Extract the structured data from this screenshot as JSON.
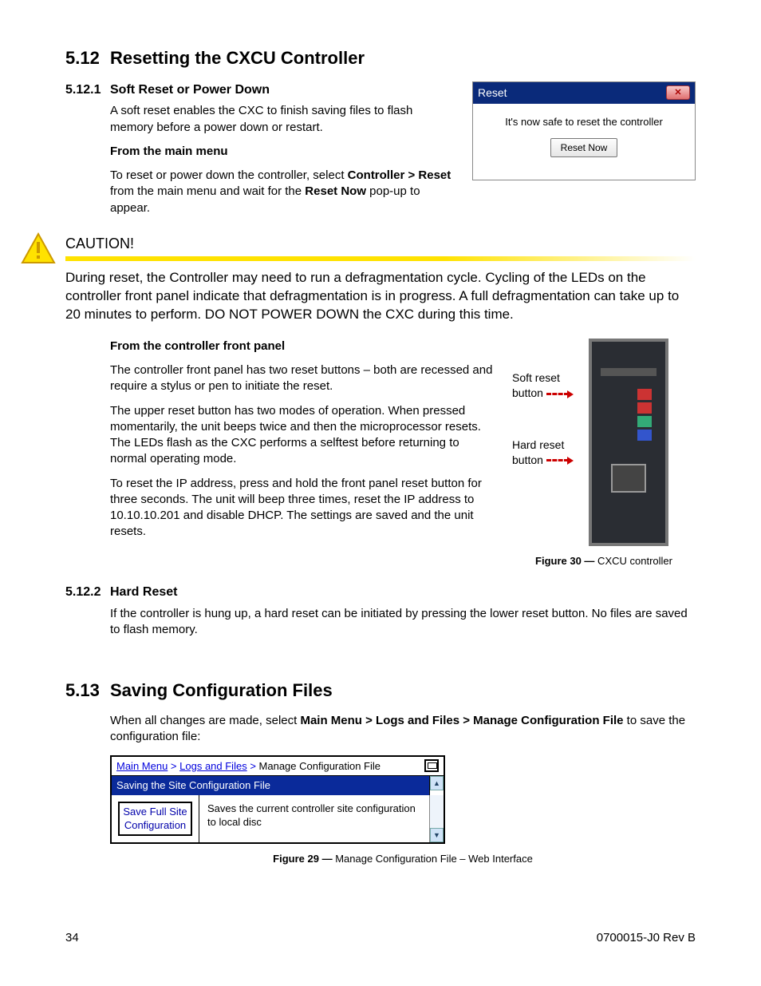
{
  "section512": {
    "num": "5.12",
    "title": "Resetting the CXCU Controller",
    "s1": {
      "num": "5.12.1",
      "title": "Soft Reset or Power Down",
      "p1": "A soft reset enables the CXC to finish saving files to flash memory before a power down or restart.",
      "h_from_main": "From the main menu",
      "p2a": "To reset or power down the controller, select ",
      "p2b": "Controller > Reset",
      "p2c": " from the main menu and wait for the ",
      "p2d": "Reset Now",
      "p2e": " pop-up to appear."
    },
    "dialog": {
      "title": "Reset",
      "msg": "It's now safe to reset the controller",
      "btn": "Reset Now"
    },
    "caution": {
      "head": "CAUTION!",
      "text": "During reset, the Controller may need to run a defragmentation cycle. Cycling of the LEDs on the controller front panel indicate that defragmentation is in progress. A full defragmentation can take up to 20 minutes to perform. DO NOT POWER DOWN the CXC during this time."
    },
    "front_panel": {
      "h": "From the controller front panel",
      "p1": "The controller front panel has two reset buttons – both are recessed and require a stylus or pen to initiate the reset.",
      "p2": "The upper reset button has two modes of operation. When pressed momentarily, the unit beeps twice and then the microprocessor resets. The LEDs flash as the CXC performs a selftest before returning to normal operating mode.",
      "p3": "To reset the IP address, press and hold the front panel reset button for three seconds. The unit will beep three times, reset the IP address to 10.10.10.201 and disable DHCP. The settings are saved and the unit resets.",
      "label_soft": "Soft reset button",
      "label_hard": "Hard reset button",
      "fig_num": "Figure 30 —",
      "fig_txt": " CXCU controller"
    },
    "s2": {
      "num": "5.12.2",
      "title": "Hard Reset",
      "p1": "If the controller is hung up, a hard reset can be initiated by pressing the lower reset button. No files are saved to flash memory."
    }
  },
  "section513": {
    "num": "5.13",
    "title": "Saving Configuration Files",
    "p1a": "When all changes are made, select ",
    "p1b": "Main Menu > Logs and Files > Manage Configuration File",
    "p1c": " to save the configuration file:",
    "win": {
      "crumb_main": "Main Menu",
      "sep1": " > ",
      "crumb_logs": "Logs and Files",
      "sep2": " > ",
      "crumb_cfg": "Manage Configuration File",
      "bluebar": "Saving the Site Configuration File",
      "btn": "Save Full Site Configuration",
      "desc": "Saves the current controller site configuration to local disc"
    },
    "fig_num": "Figure 29 —",
    "fig_txt": " Manage Configuration File – Web Interface"
  },
  "footer": {
    "page": "34",
    "doc": "0700015-J0    Rev B"
  }
}
